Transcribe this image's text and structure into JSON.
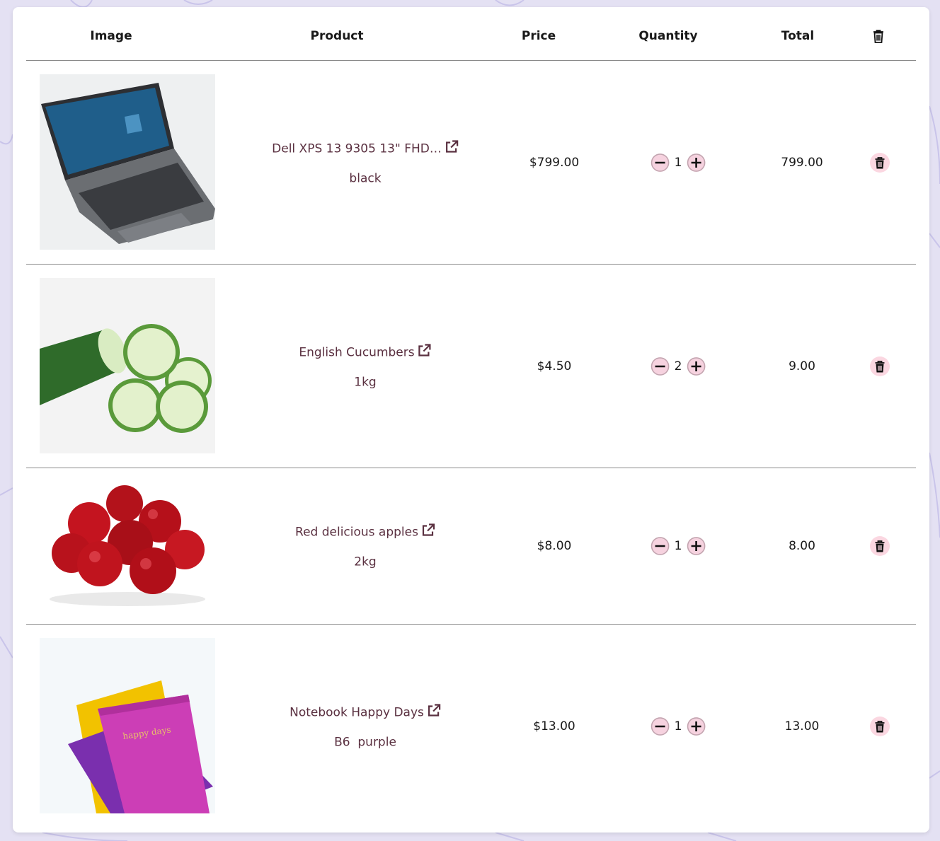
{
  "table": {
    "headers": {
      "image": "Image",
      "product": "Product",
      "price": "Price",
      "quantity": "Quantity",
      "total": "Total"
    },
    "header_delete_icon": "trash-icon",
    "rows": [
      {
        "name": "Dell XPS 13 9305 13\" FHD…",
        "variant": "black",
        "price": "$799.00",
        "quantity": "1",
        "total": "799.00",
        "image": "laptop"
      },
      {
        "name": "English Cucumbers",
        "variant": "1kg",
        "price": "$4.50",
        "quantity": "2",
        "total": "9.00",
        "image": "cucumber"
      },
      {
        "name": "Red delicious apples",
        "variant": "2kg",
        "price": "$8.00",
        "quantity": "1",
        "total": "8.00",
        "image": "apples"
      },
      {
        "name": "Notebook Happy Days",
        "variant": "B6  purple",
        "price": "$13.00",
        "quantity": "1",
        "total": "13.00",
        "image": "notebook"
      }
    ]
  },
  "colors": {
    "background": "#e4e1f3",
    "link_text": "#5a3040",
    "button_bg": "#f6d2df",
    "delete_bg": "#fbd7e1"
  }
}
